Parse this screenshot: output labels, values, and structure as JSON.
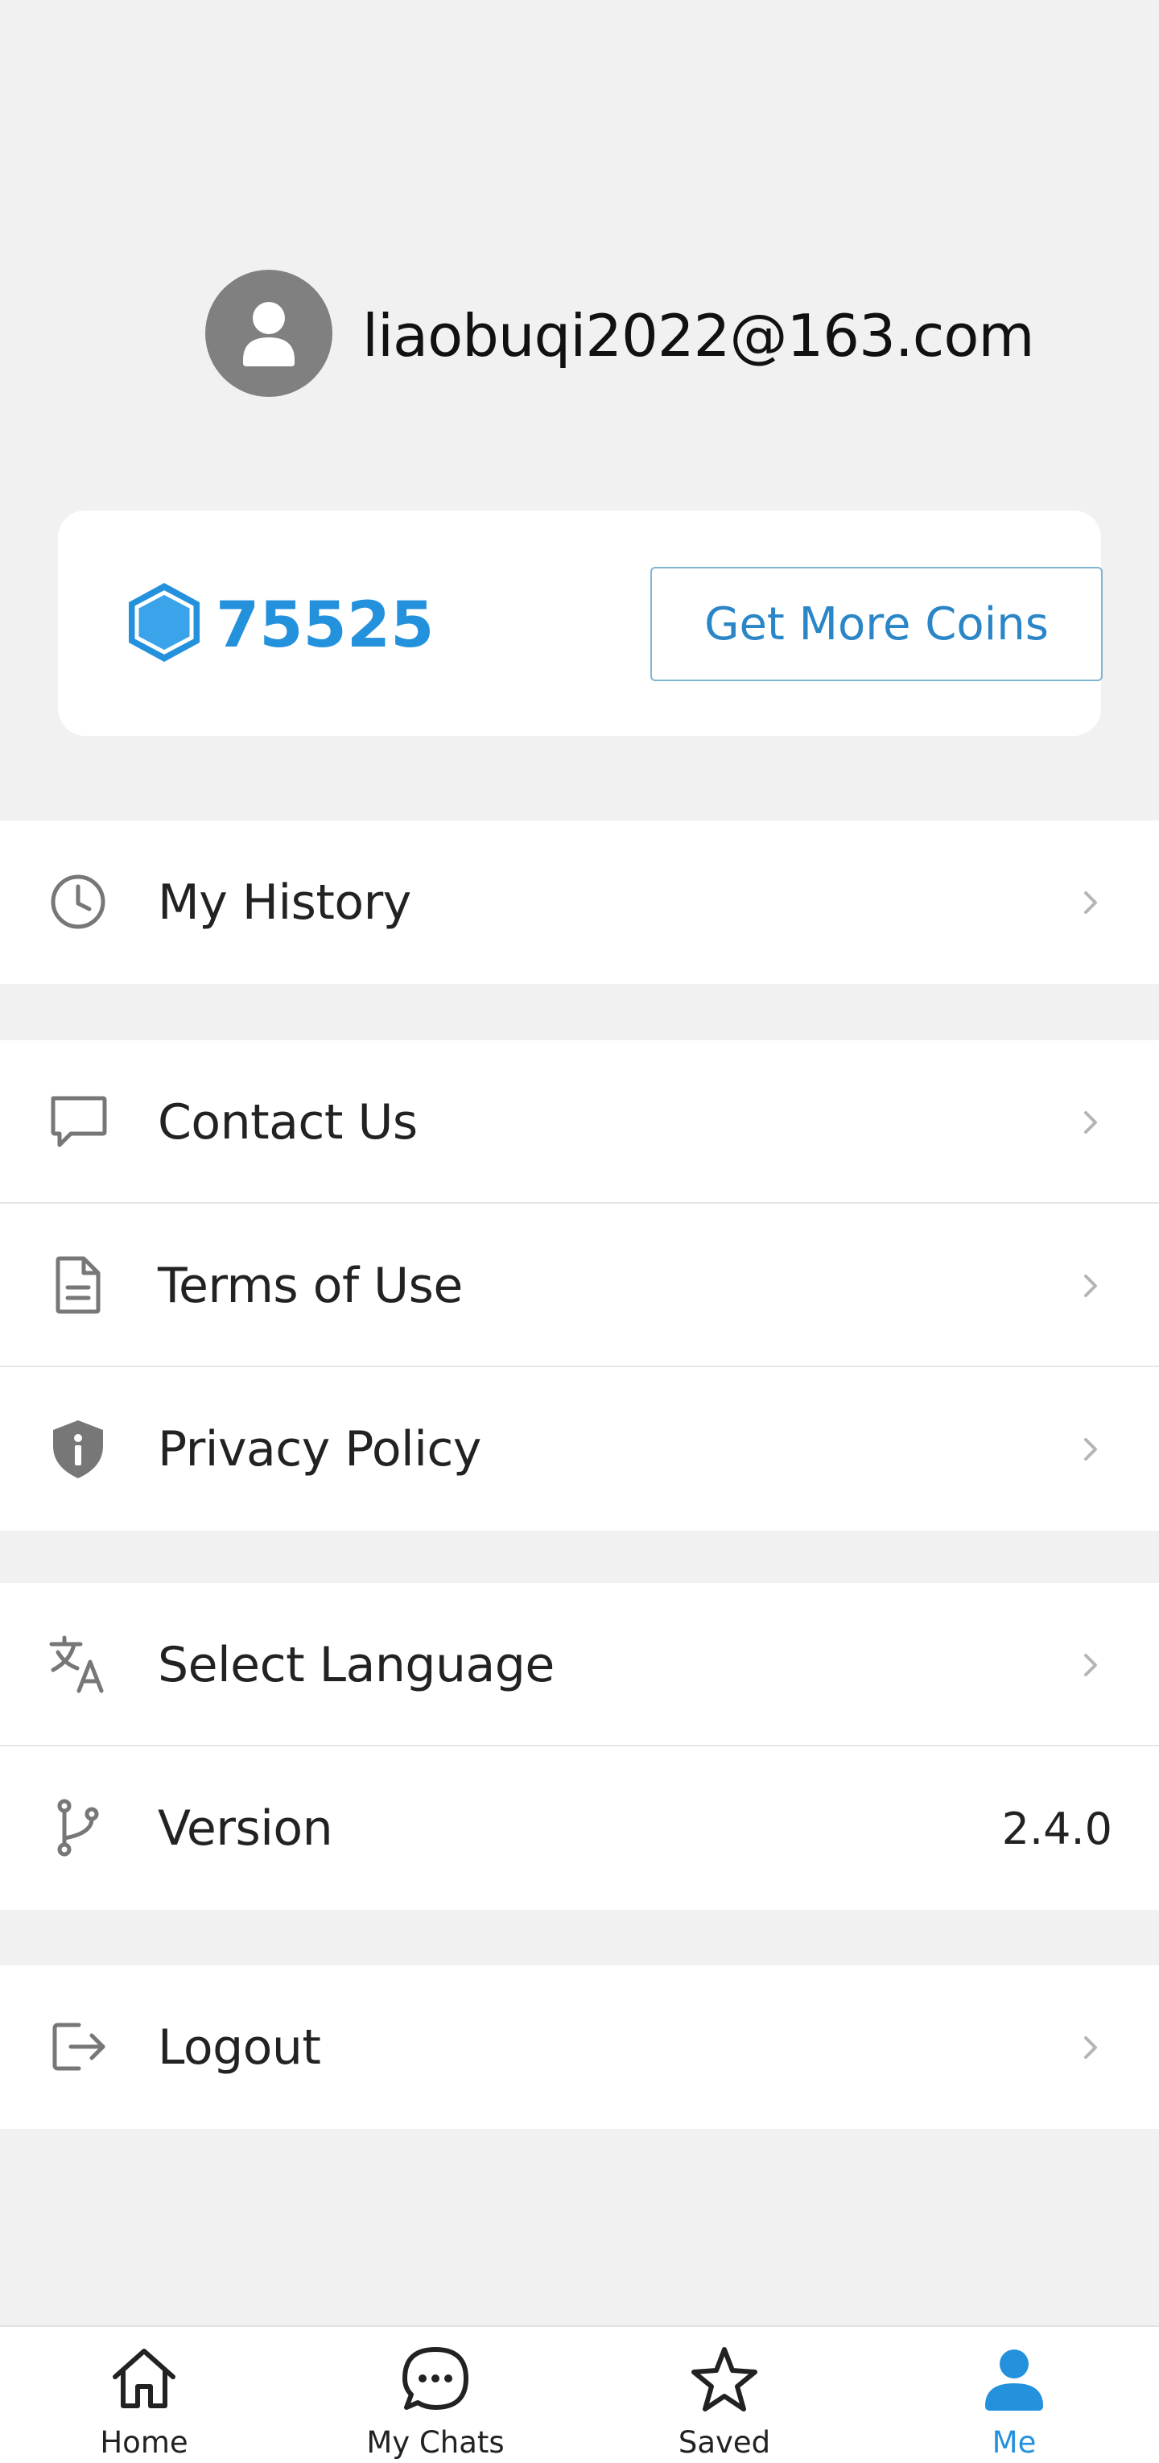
{
  "profile": {
    "email": "liaobuqi2022@163.com",
    "avatar_icon": "user-icon"
  },
  "coins": {
    "count": "75525",
    "get_more_label": "Get More Coins",
    "accent": "#2391dc"
  },
  "menu": {
    "history": {
      "label": "My History",
      "icon": "clock-icon"
    },
    "contact": {
      "label": "Contact Us",
      "icon": "chat-bubble-icon"
    },
    "terms": {
      "label": "Terms of Use",
      "icon": "document-icon"
    },
    "privacy": {
      "label": "Privacy Policy",
      "icon": "shield-info-icon"
    },
    "language": {
      "label": "Select Language",
      "icon": "translate-icon"
    },
    "version": {
      "label": "Version",
      "value": "2.4.0",
      "icon": "branch-icon"
    },
    "logout": {
      "label": "Logout",
      "icon": "logout-icon"
    }
  },
  "nav": {
    "home": "Home",
    "chats": "My Chats",
    "saved": "Saved",
    "me": "Me",
    "active": "Me"
  }
}
